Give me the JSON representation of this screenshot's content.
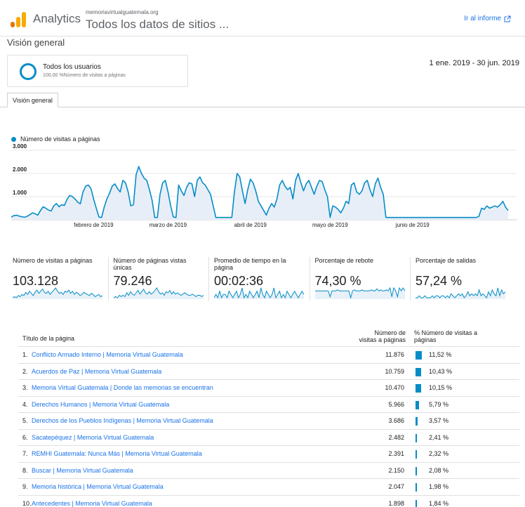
{
  "header": {
    "app_name": "Analytics",
    "account": "memoriavirtualguatemala.org",
    "property": "Todos los datos de sitios ...",
    "report_link": "Ir al informe",
    "brand_color": "#f9ab00"
  },
  "page": {
    "title": "Visión general"
  },
  "segment": {
    "name": "Todos los usuarios",
    "description": "100,00 %Número de visitas a páginas"
  },
  "date_range": "1 ene. 2019 - 30 jun. 2019",
  "tabs": [
    {
      "label": "Visión general"
    }
  ],
  "chart_data": {
    "type": "area",
    "title": "",
    "series": [
      {
        "name": "Número de visitas a páginas",
        "color": "#058dc7",
        "values": [
          120,
          180,
          200,
          160,
          130,
          110,
          150,
          220,
          300,
          260,
          200,
          400,
          560,
          500,
          420,
          380,
          600,
          700,
          560,
          650,
          620,
          880,
          1050,
          1000,
          900,
          760,
          690,
          1200,
          1450,
          1500,
          1350,
          900,
          500,
          120,
          100,
          550,
          900,
          1150,
          1450,
          1550,
          1350,
          1200,
          1700,
          1600,
          1200,
          600,
          650,
          1950,
          2300,
          2000,
          1800,
          1700,
          1300,
          850,
          100,
          100,
          1100,
          1600,
          1700,
          1200,
          600,
          120,
          100,
          1500,
          1250,
          1050,
          1400,
          1600,
          1550,
          1000,
          1700,
          1850,
          1600,
          1500,
          1300,
          1100,
          600,
          100,
          100,
          100,
          100,
          100,
          100,
          100,
          1200,
          2000,
          1850,
          1250,
          700,
          1300,
          1750,
          1600,
          1250,
          800,
          600,
          400,
          200,
          500,
          700,
          550,
          900,
          1500,
          1700,
          1450,
          1300,
          1400,
          900,
          1700,
          2000,
          1600,
          1250,
          1550,
          1700,
          1400,
          1100,
          1450,
          1700,
          1650,
          1300,
          1000,
          100,
          600,
          550,
          450,
          300,
          500,
          800,
          700,
          1500,
          1600,
          1200,
          1100,
          1250,
          1600,
          1700,
          1300,
          1000,
          1550,
          1800,
          1400,
          1100,
          100,
          100,
          100,
          100,
          100,
          100,
          100,
          100,
          100,
          100,
          100,
          100,
          100,
          100,
          100,
          100,
          100,
          100,
          100,
          100,
          100,
          100,
          100,
          100,
          100,
          100,
          100,
          100,
          100,
          100,
          100,
          100,
          100,
          100,
          100,
          150,
          500,
          450,
          600,
          500,
          550,
          600,
          550,
          650,
          800,
          550,
          400
        ]
      }
    ],
    "x_tick_labels": [
      "febrero de 2019",
      "marzo de 2019",
      "abril de 2019",
      "mayo de 2019",
      "junio de 2019"
    ],
    "y_tick_labels": [
      "1.000",
      "2.000",
      "3.000"
    ],
    "ylim": [
      0,
      3000
    ],
    "grid": true,
    "legend": "top-left"
  },
  "metrics": [
    {
      "label": "Número de visitas a páginas",
      "value": "103.128",
      "spark": [
        3,
        4,
        3,
        5,
        4,
        6,
        5,
        8,
        6,
        9,
        7,
        5,
        8,
        10,
        7,
        9,
        11,
        8,
        7,
        9,
        6,
        8,
        10,
        12,
        9,
        7,
        8,
        6,
        9,
        8,
        10,
        7,
        9,
        6,
        8,
        7,
        5,
        6,
        8,
        7,
        6,
        5,
        7,
        6,
        4,
        5,
        6,
        4,
        5
      ]
    },
    {
      "label": "Número de páginas vistas únicas",
      "value": "79.246",
      "spark": [
        3,
        4,
        3,
        5,
        4,
        5,
        4,
        7,
        5,
        8,
        6,
        5,
        7,
        9,
        6,
        8,
        10,
        7,
        6,
        8,
        6,
        7,
        9,
        11,
        8,
        6,
        7,
        5,
        8,
        7,
        9,
        6,
        8,
        6,
        7,
        6,
        5,
        6,
        7,
        6,
        5,
        5,
        6,
        5,
        4,
        5,
        5,
        4,
        5
      ]
    },
    {
      "label": "Promedio de tiempo en la página",
      "value": "00:02:36",
      "spark": [
        6,
        7,
        6,
        8,
        6,
        7,
        7,
        6,
        8,
        7,
        6,
        7,
        8,
        6,
        7,
        9,
        6,
        7,
        6,
        8,
        7,
        6,
        7,
        8,
        6,
        9,
        7,
        6,
        8,
        7,
        6,
        7,
        9,
        6,
        7,
        8,
        6,
        7,
        6,
        8,
        7,
        6,
        7,
        8,
        7,
        6,
        7,
        8,
        7
      ]
    },
    {
      "label": "Porcentaje de rebote",
      "value": "74,30 %",
      "spark": [
        8,
        8,
        8,
        8,
        8,
        8,
        8,
        8,
        2,
        8,
        8,
        8,
        9,
        8,
        8,
        8,
        8,
        8,
        8,
        1,
        8,
        9,
        8,
        8,
        8,
        9,
        8,
        8,
        8,
        8,
        9,
        8,
        8,
        10,
        8,
        9,
        8,
        8,
        9,
        8,
        11,
        2,
        11,
        8,
        2,
        11,
        8,
        11,
        8
      ]
    },
    {
      "label": "Porcentaje de salidas",
      "value": "57,24 %",
      "spark": [
        6,
        6,
        7,
        6,
        6,
        7,
        6,
        6,
        6,
        7,
        6,
        7,
        7,
        6,
        7,
        7,
        6,
        7,
        6,
        8,
        7,
        6,
        7,
        8,
        7,
        8,
        6,
        7,
        9,
        7,
        8,
        7,
        8,
        7,
        10,
        7,
        8,
        7,
        6,
        9,
        7,
        10,
        8,
        7,
        11,
        7,
        10,
        8,
        9
      ]
    }
  ],
  "metric_spark_color": "#058dc7",
  "table": {
    "header_title": "Título de la página",
    "header_visits": [
      "Número de",
      "visitas a páginas"
    ],
    "header_pct": [
      "% Número de visitas a",
      "páginas"
    ],
    "rows": [
      {
        "idx": "1.",
        "title": "Conflicto Armado Interno | Memoria Virtual Guatemala",
        "visits": "11.876",
        "pct": "11,52 %",
        "share": 11.52
      },
      {
        "idx": "2.",
        "title": "Acuerdos de Paz | Memoria Virtual Guatemala",
        "visits": "10.759",
        "pct": "10,43 %",
        "share": 10.43
      },
      {
        "idx": "3.",
        "title": "Memoria Virtual Guatemala | Donde las memorias se encuentran",
        "visits": "10.470",
        "pct": "10,15 %",
        "share": 10.15
      },
      {
        "idx": "4.",
        "title": "Derechos Humanos | Memoria Virtual Guatemala",
        "visits": "5.966",
        "pct": "5,79 %",
        "share": 5.79
      },
      {
        "idx": "5.",
        "title": "Derechos de los Pueblos Indígenas | Memoria Virtual Guatemala",
        "visits": "3.686",
        "pct": "3,57 %",
        "share": 3.57
      },
      {
        "idx": "6.",
        "title": "Sacatepéquez | Memoria Virtual Guatemala",
        "visits": "2.482",
        "pct": "2,41 %",
        "share": 2.41
      },
      {
        "idx": "7.",
        "title": "REMHI Guatemala: Nunca Más | Memoria Virtual Guatemala",
        "visits": "2.391",
        "pct": "2,32 %",
        "share": 2.32
      },
      {
        "idx": "8.",
        "title": "Buscar | Memoria Virtual Guatemala",
        "visits": "2.150",
        "pct": "2,08 %",
        "share": 2.08
      },
      {
        "idx": "9.",
        "title": "Memoria histórica | Memoria Virtual Guatemala",
        "visits": "2.047",
        "pct": "1,98 %",
        "share": 1.98
      },
      {
        "idx": "10.",
        "title": "Antecedentes | Memoria Virtual Guatemala",
        "visits": "1.898",
        "pct": "1,84 %",
        "share": 1.84
      }
    ]
  }
}
